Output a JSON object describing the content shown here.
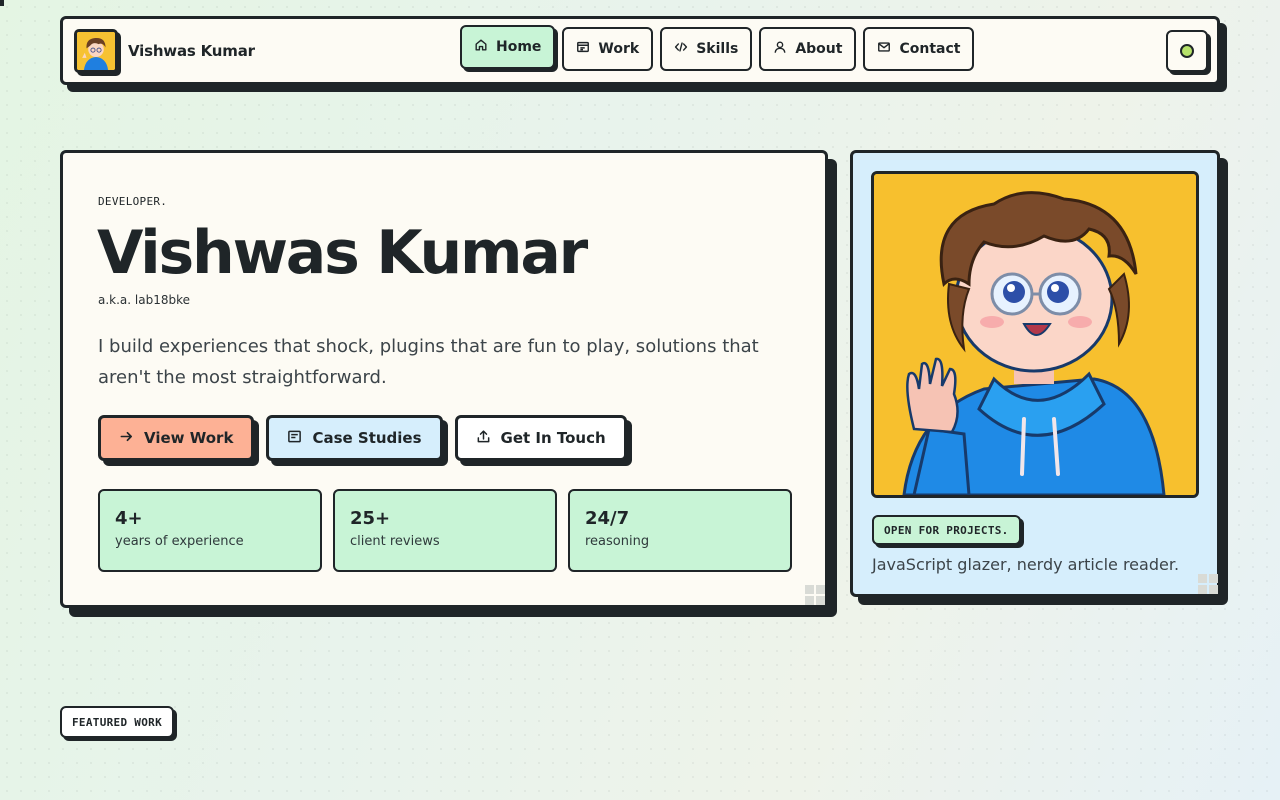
{
  "brand": {
    "name": "Vishwas Kumar"
  },
  "nav": {
    "items": [
      {
        "label": "Home",
        "active": true,
        "icon": "home-icon"
      },
      {
        "label": "Work",
        "active": false,
        "icon": "window-icon"
      },
      {
        "label": "Skills",
        "active": false,
        "icon": "code-icon"
      },
      {
        "label": "About",
        "active": false,
        "icon": "user-icon"
      },
      {
        "label": "Contact",
        "active": false,
        "icon": "mail-icon"
      }
    ]
  },
  "hero": {
    "eyebrow": "DEVELOPER.",
    "title": "Vishwas Kumar",
    "aka": "a.k.a. lab18bke",
    "tagline": "I build experiences that shock, plugins that are fun to play, solutions that aren't the most straightforward.",
    "buttons": [
      {
        "label": "View Work",
        "icon": "arrow-right-icon"
      },
      {
        "label": "Case Studies",
        "icon": "document-icon"
      },
      {
        "label": "Get In Touch",
        "icon": "upload-icon"
      }
    ],
    "stats": [
      {
        "value": "4+",
        "label": "years of experience"
      },
      {
        "value": "25+",
        "label": "client reviews"
      },
      {
        "value": "24/7",
        "label": "reasoning"
      }
    ]
  },
  "profile": {
    "status": "OPEN FOR PROJECTS.",
    "bio": "JavaScript glazer, nerdy article reader."
  },
  "sections": {
    "featured": "FEATURED WORK"
  },
  "colors": {
    "ink": "#1f2528",
    "mint": "#c8f4d6",
    "peach": "#fdb195",
    "sky": "#d6eefc",
    "portrait_bg": "#f7c02e",
    "theme_dot": "#b6e26a"
  }
}
